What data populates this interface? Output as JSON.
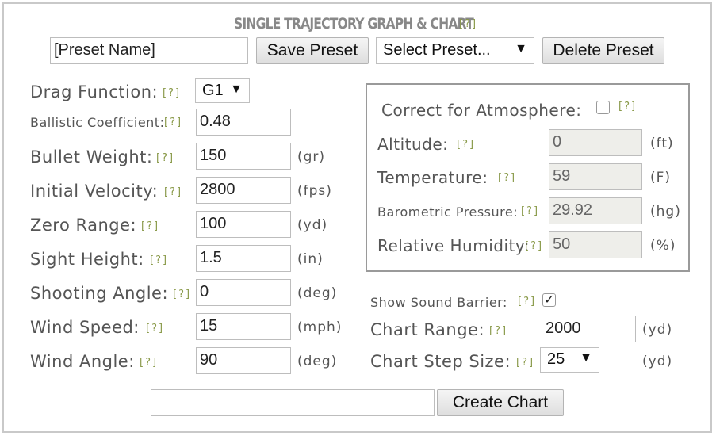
{
  "header": {
    "title": "SINGLE TRAJECTORY GRAPH & CHART",
    "help": "[?]"
  },
  "preset": {
    "name_value": "[Preset Name]",
    "save_label": "Save Preset",
    "select_value": "Select Preset...",
    "delete_label": "Delete Preset"
  },
  "help_text": "[?]",
  "left": {
    "drag": {
      "label": "Drag Function:",
      "value": "G1"
    },
    "bc": {
      "label": "Ballistic Coefficient:",
      "value": "0.48"
    },
    "weight": {
      "label": "Bullet Weight:",
      "value": "150",
      "unit": "(gr)"
    },
    "velocity": {
      "label": "Initial Velocity:",
      "value": "2800",
      "unit": "(fps)"
    },
    "zero": {
      "label": "Zero Range:",
      "value": "100",
      "unit": "(yd)"
    },
    "sight": {
      "label": "Sight Height:",
      "value": "1.5",
      "unit": "(in)"
    },
    "angle": {
      "label": "Shooting Angle:",
      "value": "0",
      "unit": "(deg)"
    },
    "wind_speed": {
      "label": "Wind Speed:",
      "value": "15",
      "unit": "(mph)"
    },
    "wind_angle": {
      "label": "Wind Angle:",
      "value": "90",
      "unit": "(deg)"
    }
  },
  "atmosphere": {
    "correct_label": "Correct for Atmosphere:",
    "correct_checked": false,
    "altitude": {
      "label": "Altitude:",
      "value": "0",
      "unit": "(ft)"
    },
    "temperature": {
      "label": "Temperature:",
      "value": "59",
      "unit": "(F)"
    },
    "pressure": {
      "label": "Barometric Pressure:",
      "value": "29.92",
      "unit": "(hg)"
    },
    "humidity": {
      "label": "Relative Humidity:",
      "value": "50",
      "unit": "(%)"
    }
  },
  "chart_opts": {
    "sound_label": "Show Sound Barrier:",
    "sound_checked": true,
    "range": {
      "label": "Chart Range:",
      "value": "2000",
      "unit": "(yd)"
    },
    "step": {
      "label": "Chart Step Size:",
      "value": "25",
      "unit": "(yd)"
    }
  },
  "footer": {
    "name_value": "",
    "create_label": "Create Chart"
  }
}
